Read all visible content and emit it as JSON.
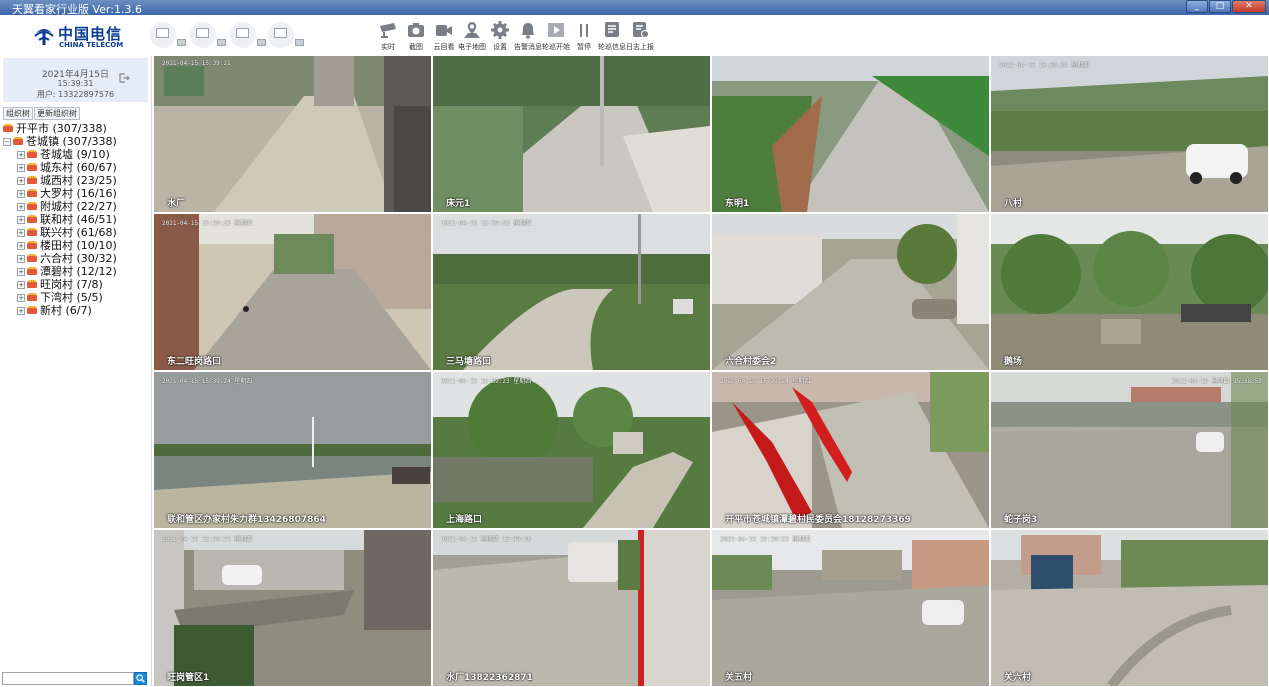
{
  "window": {
    "title": "天翼看家行业版 Ver:1.3.6",
    "min": "_",
    "max": "□",
    "close": "✕"
  },
  "brand": {
    "cn": "中国电信",
    "en": "CHINA TELECOM",
    "color": "#0a3d91"
  },
  "toolbar": [
    {
      "label": "实时",
      "icon": "cctv-camera-icon"
    },
    {
      "label": "截图",
      "icon": "camera-snapshot-icon"
    },
    {
      "label": "云回看",
      "icon": "cloud-playback-icon"
    },
    {
      "label": "电子地图",
      "icon": "map-pin-icon"
    },
    {
      "label": "设置",
      "icon": "gear-icon"
    },
    {
      "label": "告警消息",
      "icon": "bell-icon"
    },
    {
      "label": "轮巡开始",
      "icon": "play-icon"
    },
    {
      "label": "暂停",
      "icon": "pause-icon"
    },
    {
      "label": "轮巡信息",
      "icon": "info-list-icon"
    },
    {
      "label": "日志上报",
      "icon": "log-upload-icon"
    }
  ],
  "user": {
    "date": "2021年4月15日",
    "time": "15:39:31",
    "account": "用户: 13322897576"
  },
  "sidebar": {
    "org_tree_btn": "组织树",
    "refresh_tree_btn": "更新组织树",
    "tree": [
      {
        "label": "开平市 (307/338)",
        "level": 0,
        "exp": "",
        "icon": true
      },
      {
        "label": "苍城镇 (307/338)",
        "level": 1,
        "exp": "−",
        "icon": true
      },
      {
        "label": "苍城墟 (9/10)",
        "level": 2,
        "exp": "+",
        "icon": true
      },
      {
        "label": "城东村 (60/67)",
        "level": 2,
        "exp": "+",
        "icon": true
      },
      {
        "label": "城西村 (23/25)",
        "level": 2,
        "exp": "+",
        "icon": true
      },
      {
        "label": "大罗村 (16/16)",
        "level": 2,
        "exp": "+",
        "icon": true
      },
      {
        "label": "附城村 (22/27)",
        "level": 2,
        "exp": "+",
        "icon": true
      },
      {
        "label": "联和村 (46/51)",
        "level": 2,
        "exp": "+",
        "icon": true
      },
      {
        "label": "联兴村 (61/68)",
        "level": 2,
        "exp": "+",
        "icon": true
      },
      {
        "label": "楼田村 (10/10)",
        "level": 2,
        "exp": "+",
        "icon": true
      },
      {
        "label": "六合村 (30/32)",
        "level": 2,
        "exp": "+",
        "icon": true
      },
      {
        "label": "潭碧村 (12/12)",
        "level": 2,
        "exp": "+",
        "icon": true
      },
      {
        "label": "旺岗村 (7/8)",
        "level": 2,
        "exp": "+",
        "icon": true
      },
      {
        "label": "下湾村 (5/5)",
        "level": 2,
        "exp": "+",
        "icon": true
      },
      {
        "label": "新村 (6/7)",
        "level": 2,
        "exp": "+",
        "icon": true
      }
    ],
    "search_placeholder": ""
  },
  "cameras": [
    {
      "name": "水厂",
      "osd": "2021-04-15 15:39:21",
      "scene": "dirt",
      "selected": false
    },
    {
      "name": "床元1",
      "osd": "",
      "scene": "concrete",
      "selected": false
    },
    {
      "name": "东明1",
      "osd": "",
      "scene": "field",
      "selected": false
    },
    {
      "name": "八村",
      "osd": "2021-04-15 15:39:24 星期四",
      "scene": "car",
      "selected": false
    },
    {
      "name": "东二旺岗路口",
      "osd": "2021-04-15 15:39:23 星期四",
      "scene": "village",
      "selected": false
    },
    {
      "name": "三马塘路口",
      "osd": "2021-04-15 15:39:22 星期四",
      "scene": "curve",
      "selected": false
    },
    {
      "name": "六合村委会2",
      "osd": "",
      "scene": "wall",
      "selected": false
    },
    {
      "name": "鹅场",
      "osd": "",
      "scene": "trees",
      "selected": false
    },
    {
      "name": "联和管区办家村朱力群13426807864",
      "osd": "2021-04-15 15:39:24 星期四",
      "scene": "pond",
      "selected": false
    },
    {
      "name": "上海路口",
      "osd": "2021-04-15 15:39:23 星期四",
      "scene": "river",
      "selected": true
    },
    {
      "name": "开平市苍城镇潭碧村民委员会18128273369",
      "osd": "2021-04-15 15:39:24 星期四",
      "scene": "flags",
      "selected": false
    },
    {
      "name": "蛇子岗3",
      "osd": "2021-04-15 星期四 15:38:52",
      "osdRight": true,
      "scene": "yard",
      "selected": false
    },
    {
      "name": "旺岗管区1",
      "osd": "2021-04-15 15:39:23 星期四",
      "scene": "canal",
      "selected": false
    },
    {
      "name": "水厂13822362871",
      "osd": "2021-04-15 星期四 15:39:26",
      "scene": "van",
      "selected": false
    },
    {
      "name": "关五村",
      "osd": "2021-04-15 15:39:23 星期四",
      "scene": "square",
      "selected": false
    },
    {
      "name": "关六村",
      "osd": "",
      "scene": "truck",
      "selected": false
    }
  ]
}
